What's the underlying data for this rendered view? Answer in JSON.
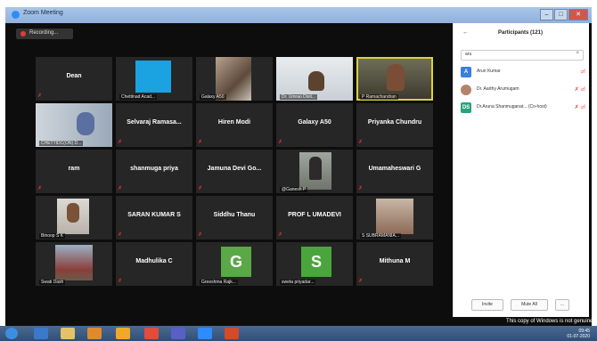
{
  "window": {
    "title": "Zoom Meeting",
    "minimize": "–",
    "maximize": "□",
    "close": "✕"
  },
  "recording": {
    "label": "Recording..."
  },
  "tiles": [
    {
      "name": "Dean",
      "label": ""
    },
    {
      "name": "",
      "label": "Chettinad Acad..."
    },
    {
      "name": "",
      "label": "Galaxy A50"
    },
    {
      "name": "",
      "label": "Dr. Umrao Dixit..."
    },
    {
      "name": "",
      "label": "P Ramachandran"
    },
    {
      "name": "",
      "label": "CHETTIDC(ON) D..."
    },
    {
      "name": "Selvaraj Ramasa...",
      "label": ""
    },
    {
      "name": "Hiren Modi",
      "label": ""
    },
    {
      "name": "Galaxy A50",
      "label": ""
    },
    {
      "name": "Priyanka Chundru",
      "label": ""
    },
    {
      "name": "ram",
      "label": ""
    },
    {
      "name": "shanmuga priya",
      "label": ""
    },
    {
      "name": "Jamuna Devi Go...",
      "label": ""
    },
    {
      "name": "",
      "label": "@Ganesh P"
    },
    {
      "name": "Umamaheswari G",
      "label": ""
    },
    {
      "name": "",
      "label": "Binoop S K"
    },
    {
      "name": "SARAN KUMAR S",
      "label": ""
    },
    {
      "name": "Siddhu Thanu",
      "label": ""
    },
    {
      "name": "PROF L UMADEVI",
      "label": ""
    },
    {
      "name": "",
      "label": "S SUBRAMANIA..."
    },
    {
      "name": "",
      "label": "Swati Dash"
    },
    {
      "name": "Madhulika C",
      "label": ""
    },
    {
      "name": "G",
      "label": "Greeshma Rajk..."
    },
    {
      "name": "S",
      "label": "sweta priyadar..."
    },
    {
      "name": "Mithuna M",
      "label": ""
    }
  ],
  "participants": {
    "title": "Participants (121)",
    "back": "←",
    "search_value": "aru",
    "clear": "×",
    "list": [
      {
        "initial": "A",
        "name": "Arun Kumar",
        "color": "#3b7de0"
      },
      {
        "initial": "",
        "name": "Dr. Aarthy Arumugam",
        "color": "#b5836a"
      },
      {
        "initial": "DS",
        "name": "Dr.Aruna Shanmuganat... (Co-host)",
        "color": "#2aa37a"
      }
    ],
    "invite": "Invite",
    "mute_all": "Mute All",
    "more": "..."
  },
  "watermark": "This copy of Windows is not genuine",
  "clock": {
    "time": "09:45",
    "date": "01-07-2020"
  }
}
